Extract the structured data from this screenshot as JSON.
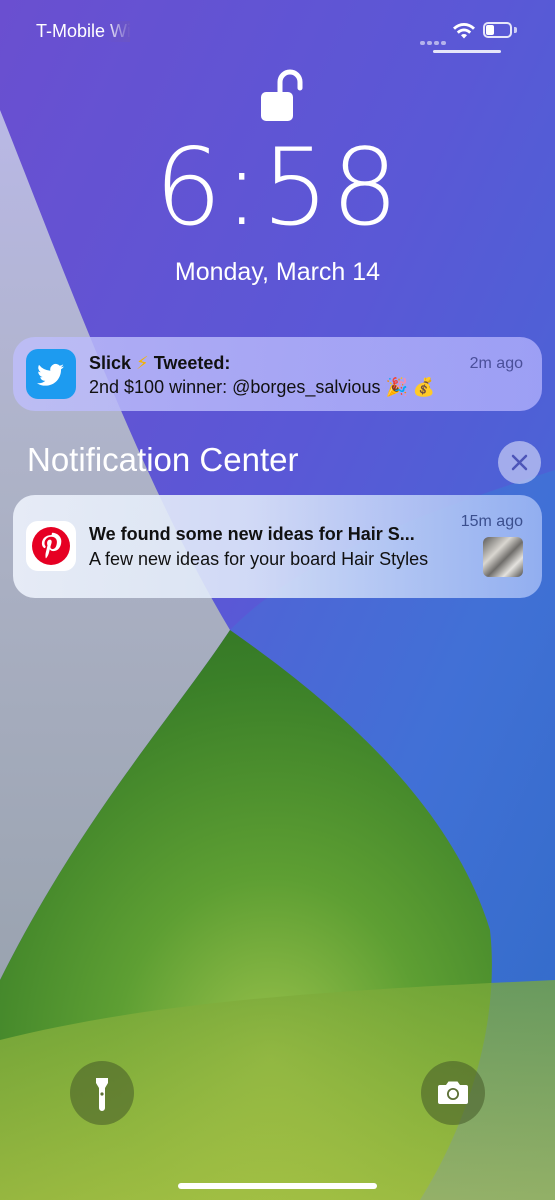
{
  "status_bar": {
    "carrier": "T-Mobile Wi-Fi",
    "wifi_icon": "wifi-icon",
    "battery_icon": "battery-icon"
  },
  "lock_screen": {
    "lock_icon": "unlocked-padlock-icon",
    "time": "6:58",
    "date": "Monday, March 14"
  },
  "notifications": [
    {
      "app_icon": "twitter-icon",
      "title_name": "Slick",
      "title_emoji": "⚡",
      "title_action": "Tweeted:",
      "body": "2nd $100 winner: @borges_salvious",
      "body_emoji": "🎉 💰",
      "time": "2m ago"
    }
  ],
  "notification_center": {
    "header": "Notification Center",
    "close_icon": "close-icon",
    "items": [
      {
        "app_icon": "pinterest-icon",
        "title": "We found some new ideas for Hair S...",
        "body": "A few new ideas for your board Hair Styles",
        "time": "15m ago",
        "thumbnail": "hair-styles-thumbnail"
      }
    ]
  },
  "bottom_controls": {
    "flashlight_icon": "flashlight-icon",
    "camera_icon": "camera-icon"
  },
  "colors": {
    "twitter_blue": "#1d9bf0",
    "pinterest_red": "#e60023",
    "wallpaper_purple": "#5b4fd1",
    "wallpaper_blue": "#3d6fd6",
    "wallpaper_green": "#3f8a2c",
    "wallpaper_yellow_green": "#a9c24a"
  }
}
